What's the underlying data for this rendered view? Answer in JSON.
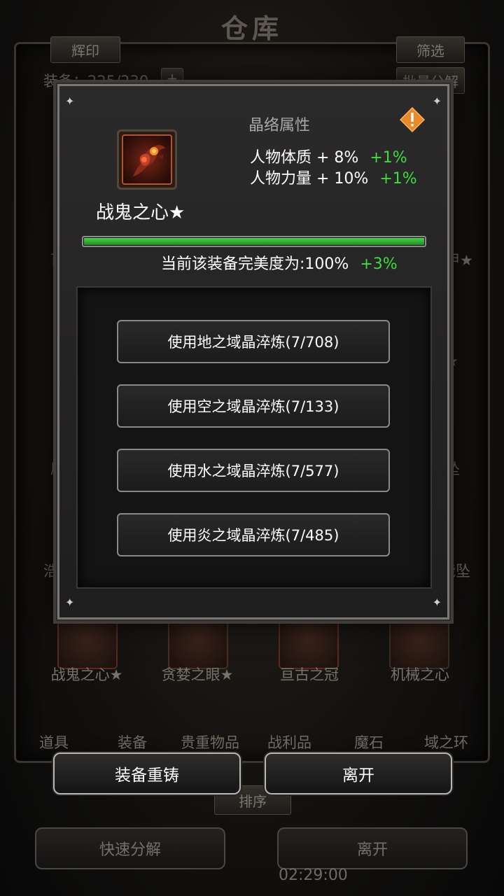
{
  "background": {
    "title": "仓库",
    "emblem_button": "辉印",
    "filter_button": "筛选",
    "batch_button": "批量分解",
    "equip_count_label": "装备：225/230",
    "plus_label": "+",
    "item_labels": [
      "战鬼之心★",
      "贪婪之眼★",
      "亘古之冠",
      "机械之心"
    ],
    "side_labels_left": [
      "百",
      "原",
      "浩"
    ],
    "side_labels_right": [
      "甲★",
      "★",
      "坠",
      "能坠"
    ],
    "tabs": [
      "道具",
      "装备",
      "贵重物品",
      "战利品",
      "魔石",
      "域之环"
    ],
    "sort_button": "排序",
    "quick_decompose": "快速分解",
    "leave": "离开",
    "clock": "02:29:00"
  },
  "modal": {
    "item_name": "战鬼之心★",
    "attr_title": "晶络属性",
    "attributes": [
      {
        "text": "人物体质 + 8%",
        "bonus": "+1%"
      },
      {
        "text": "人物力量 + 10%",
        "bonus": "+1%"
      }
    ],
    "perfection_text": "当前该装备完美度为:100%",
    "perfection_bonus": "+3%",
    "perfection_value": 1.0,
    "refine_buttons": [
      "使用地之域晶淬炼(7/708)",
      "使用空之域晶淬炼(7/133)",
      "使用水之域晶淬炼(7/577)",
      "使用炎之域晶淬炼(7/485)"
    ],
    "icons": {
      "warning": "warning-icon",
      "item": "heart-item-icon"
    },
    "colors": {
      "bonus": "#3ddc3d",
      "progress": "#2fb52f",
      "warning": "#e8892a"
    }
  },
  "actions": {
    "reforge": "装备重铸",
    "leave": "离开"
  }
}
